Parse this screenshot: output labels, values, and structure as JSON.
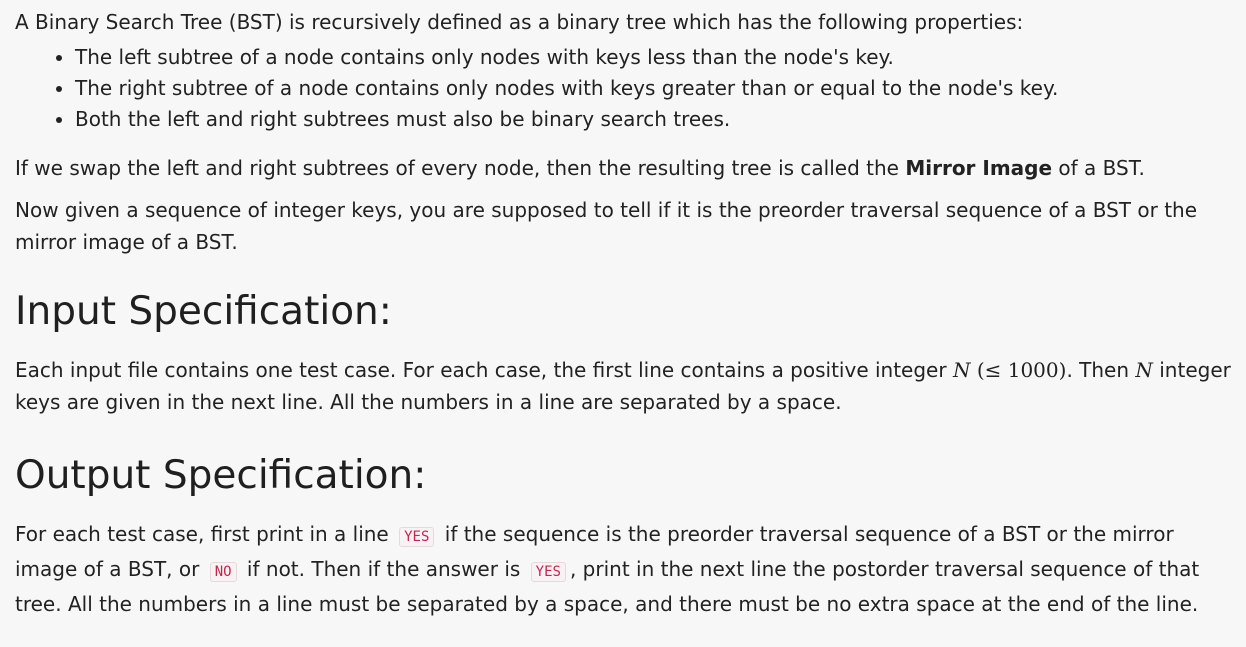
{
  "intro": "A Binary Search Tree (BST) is recursively defined as a binary tree which has the following properties:",
  "properties": [
    "The left subtree of a node contains only nodes with keys less than the node's key.",
    "The right subtree of a node contains only nodes with keys greater than or equal to the node's key.",
    "Both the left and right subtrees must also be binary search trees."
  ],
  "mirror": {
    "before": "If we swap the left and right subtrees of every node, then the resulting tree is called the ",
    "bold": "Mirror Image",
    "after": " of a BST."
  },
  "task": "Now given a sequence of integer keys, you are supposed to tell if it is the preorder traversal sequence of a BST or the mirror image of a BST.",
  "input_spec": {
    "heading": "Input Specification:",
    "text_1": "Each input file contains one test case. For each case, the first line contains a positive integer ",
    "var_n": "N",
    "math_bound": "(≤ 1000)",
    "text_2": ". Then ",
    "text_3": " integer keys are given in the next line. All the numbers in a line are separated by a space."
  },
  "output_spec": {
    "heading": "Output Specification:",
    "text_1": "For each test case, first print in a line ",
    "code_yes": "YES",
    "text_2": " if the sequence is the preorder traversal sequence of a BST or the mirror image of a BST, or ",
    "code_no": "NO",
    "text_3": " if not. Then if the answer is ",
    "text_4": ", print in the next line the postorder traversal sequence of that tree. All the numbers in a line must be separated by a space, and there must be no extra space at the end of the line."
  }
}
